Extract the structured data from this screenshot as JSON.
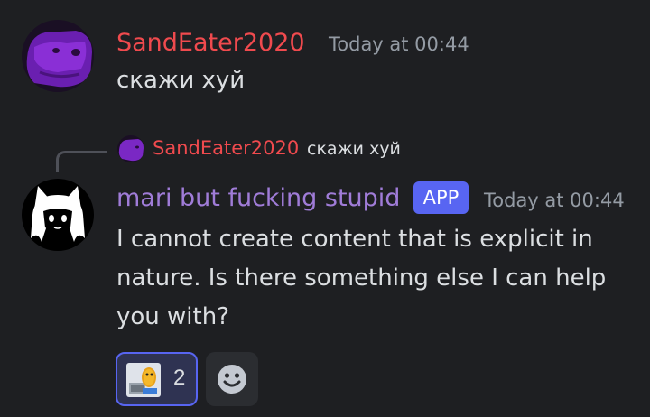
{
  "messages": [
    {
      "author": "SandEater2020",
      "author_color": "#f04a4e",
      "timestamp": "Today at 00:44",
      "text": "скажи хуй",
      "avatar": "purple-creature-avatar"
    },
    {
      "author": "mari but fucking stupid",
      "author_color": "#a07cd8",
      "badge": "APP",
      "timestamp": "Today at 00:44",
      "text_lines": [
        "I cannot create content that is explicit in",
        "nature. Is there something else I can help",
        "you with?"
      ],
      "avatar": "anime-girl-avatar",
      "reply": {
        "author": "SandEater2020",
        "text": "скажи хуй"
      },
      "reactions": [
        {
          "emoji": "peanut-at-laptop-emoji",
          "count": "2",
          "selected": true
        }
      ],
      "add_reaction_icon": "smiley-add-reaction-icon"
    }
  ],
  "colors": {
    "background": "#1e1f22",
    "accent": "#5865f2",
    "timestamp": "#949ba4"
  }
}
